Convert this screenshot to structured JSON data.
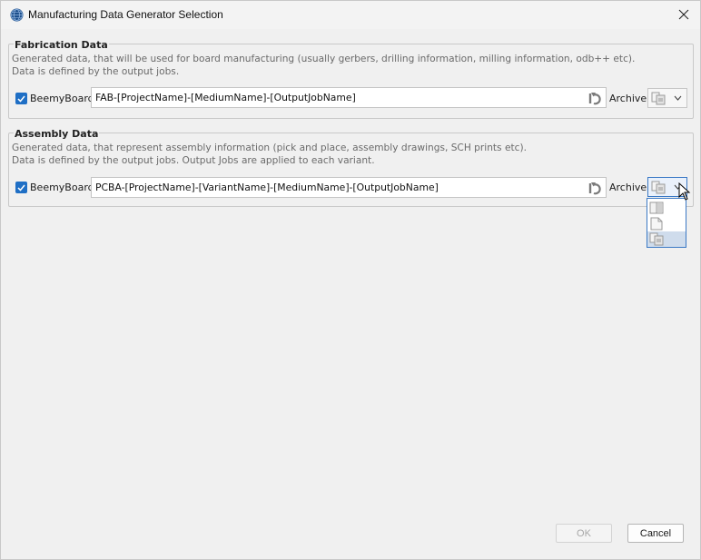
{
  "window": {
    "title": "Manufacturing Data Generator Selection",
    "app_icon": "globe-icon",
    "close_icon": "close-icon"
  },
  "fabrication": {
    "title": "Fabrication Data",
    "desc_line1": "Generated data, that will be used for board manufacturing (usually gerbers, drilling information, milling information, odb++ etc).",
    "desc_line2": "Data is defined by the output jobs.",
    "checkbox_checked": true,
    "board_label": "BeemyBoard",
    "path": "FAB-[ProjectName]-[MediumName]-[OutputJobName]",
    "archive_label": "Archive",
    "archive_icon": "archive-stacked-icon"
  },
  "assembly": {
    "title": "Assembly Data",
    "desc_line1": "Generated data, that represent assembly information (pick and place, assembly drawings, SCH prints etc).",
    "desc_line2": "Data is defined by the output jobs. Output Jobs are applied to each variant.",
    "checkbox_checked": true,
    "board_label": "BeemyBoard",
    "path": "PCBA-[ProjectName]-[VariantName]-[MediumName]-[OutputJobName]",
    "archive_label": "Archive",
    "archive_icon": "archive-stacked-icon",
    "dropdown_options": [
      "folder-split-icon",
      "single-file-icon",
      "archive-stacked-icon"
    ],
    "dropdown_selected": 2
  },
  "buttons": {
    "ok": "OK",
    "cancel": "Cancel"
  },
  "colors": {
    "accent": "#1f6fc5",
    "background": "#f0f0f0",
    "dropdown_selected": "#cfdcec"
  }
}
